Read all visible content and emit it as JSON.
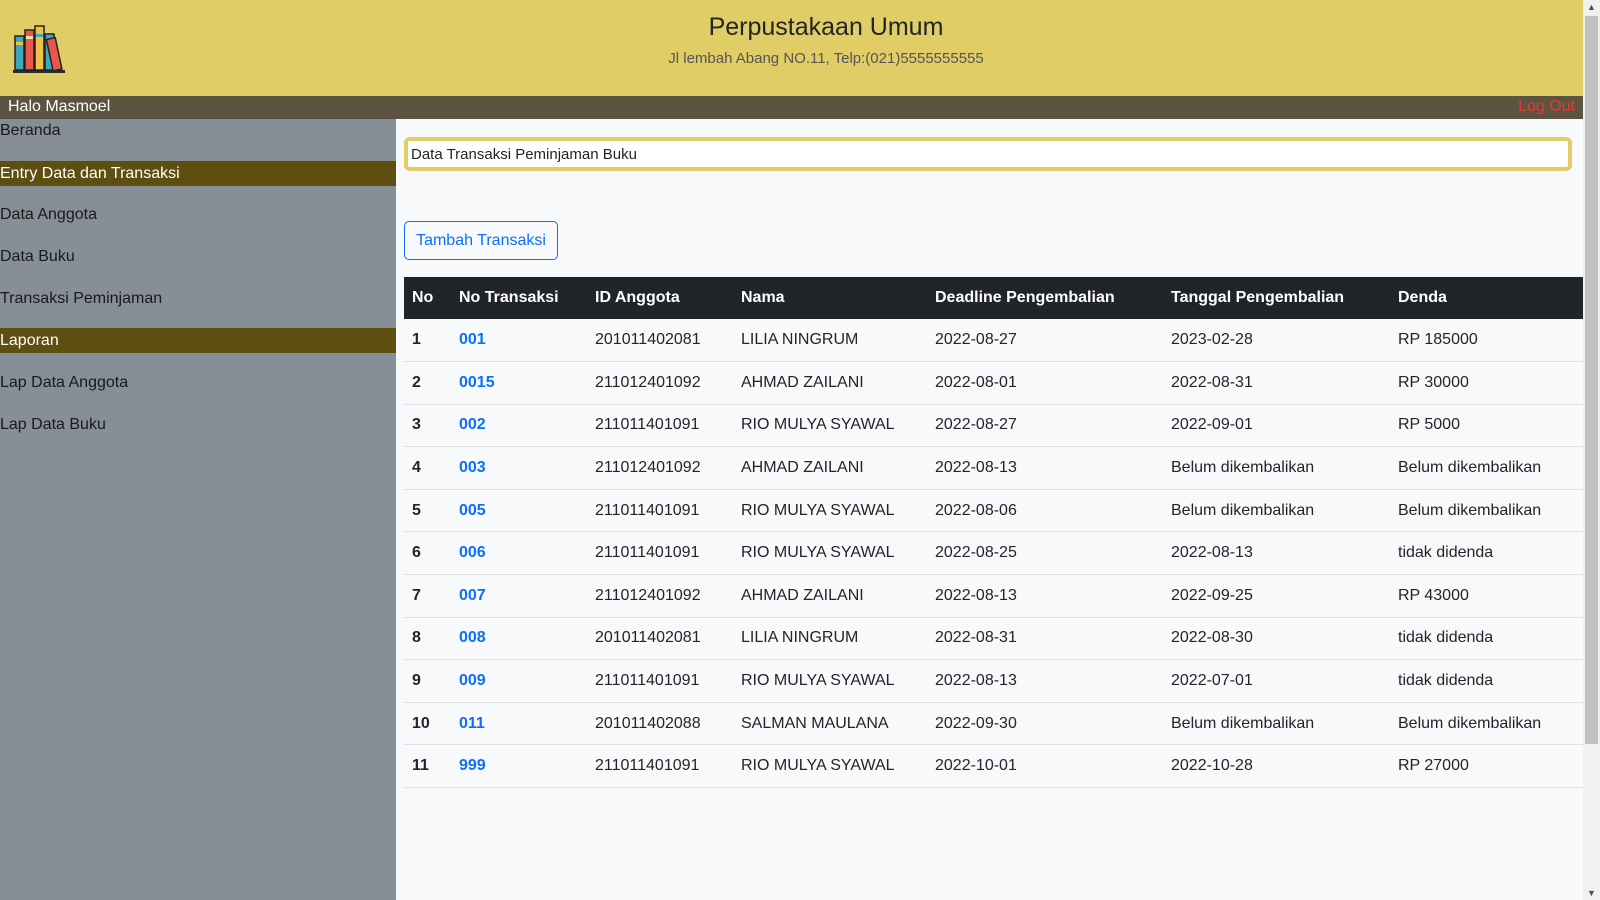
{
  "header": {
    "title": "Perpustakaan Umum",
    "subtitle": "Jl lembah Abang NO.11, Telp:(021)5555555555",
    "logo_icon": "books-icon"
  },
  "userbar": {
    "greeting": "Halo Masmoel",
    "logout_label": "Log Out"
  },
  "sidebar": {
    "home": "Beranda",
    "section1": "Entry Data dan Transaksi",
    "items1": [
      "Data Anggota",
      "Data Buku",
      "Transaksi Peminjaman"
    ],
    "section2": "Laporan",
    "items2": [
      "Lap Data Anggota",
      "Lap Data Buku"
    ]
  },
  "main": {
    "page_title": "Data Transaksi Peminjaman Buku",
    "add_button": "Tambah Transaksi"
  },
  "table": {
    "columns": [
      "No",
      "No Transaksi",
      "ID Anggota",
      "Nama",
      "Deadline Pengembalian",
      "Tanggal Pengembalian",
      "Denda"
    ],
    "rows": [
      [
        "1",
        "001",
        "201011402081",
        "LILIA NINGRUM",
        "2022-08-27",
        "2023-02-28",
        "RP 185000"
      ],
      [
        "2",
        "0015",
        "211012401092",
        "AHMAD ZAILANI",
        "2022-08-01",
        "2022-08-31",
        "RP 30000"
      ],
      [
        "3",
        "002",
        "211011401091",
        "RIO MULYA SYAWAL",
        "2022-08-27",
        "2022-09-01",
        "RP 5000"
      ],
      [
        "4",
        "003",
        "211012401092",
        "AHMAD ZAILANI",
        "2022-08-13",
        "Belum dikembalikan",
        "Belum dikembalikan"
      ],
      [
        "5",
        "005",
        "211011401091",
        "RIO MULYA SYAWAL",
        "2022-08-06",
        "Belum dikembalikan",
        "Belum dikembalikan"
      ],
      [
        "6",
        "006",
        "211011401091",
        "RIO MULYA SYAWAL",
        "2022-08-25",
        "2022-08-13",
        "tidak didenda"
      ],
      [
        "7",
        "007",
        "211012401092",
        "AHMAD ZAILANI",
        "2022-08-13",
        "2022-09-25",
        "RP 43000"
      ],
      [
        "8",
        "008",
        "201011402081",
        "LILIA NINGRUM",
        "2022-08-31",
        "2022-08-30",
        "tidak didenda"
      ],
      [
        "9",
        "009",
        "211011401091",
        "RIO MULYA SYAWAL",
        "2022-08-13",
        "2022-07-01",
        "tidak didenda"
      ],
      [
        "10",
        "011",
        "201011402088",
        "SALMAN MAULANA",
        "2022-09-30",
        "Belum dikembalikan",
        "Belum dikembalikan"
      ],
      [
        "11",
        "999",
        "211011401091",
        "RIO MULYA SYAWAL",
        "2022-10-01",
        "2022-10-28",
        "RP 27000"
      ]
    ]
  },
  "colors": {
    "header_bg": "#e0cd66",
    "userbar_bg": "#5c5440",
    "sidebar_bg": "#868e96",
    "section_bg": "#5e4e10",
    "table_head_bg": "#212529",
    "link": "#0d6efd",
    "logout": "#e53935"
  }
}
